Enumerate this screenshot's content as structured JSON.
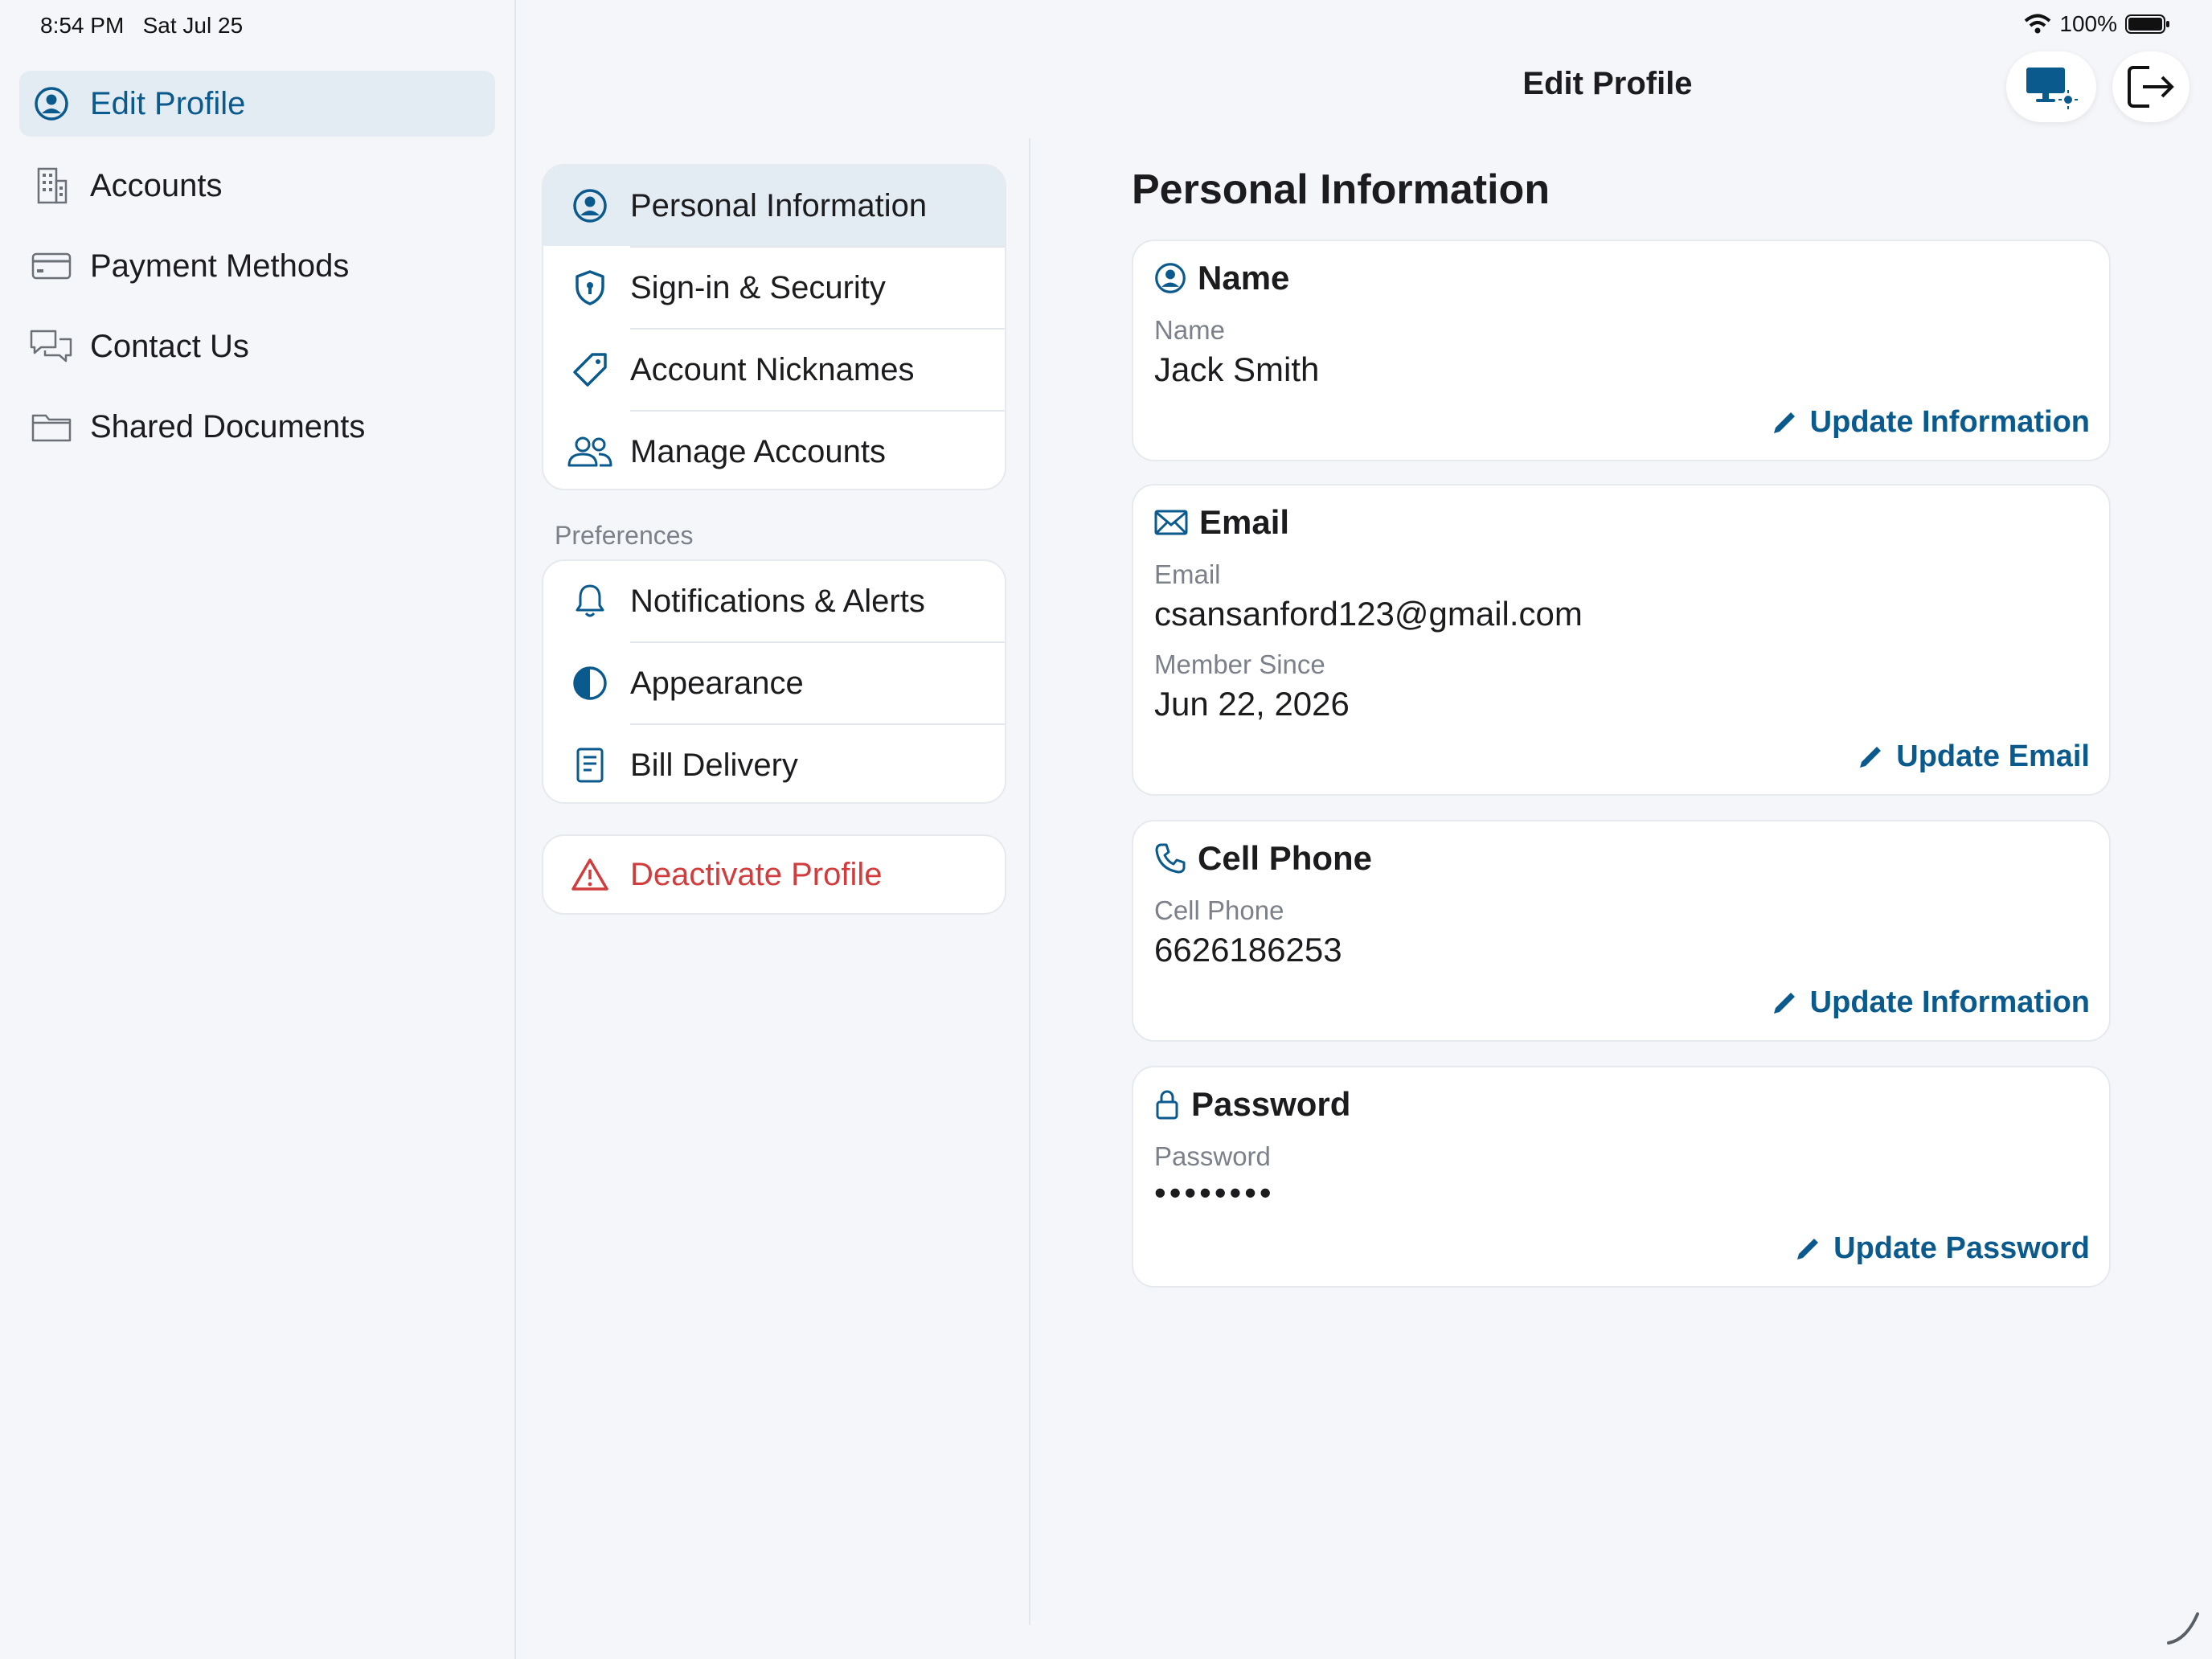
{
  "status_bar": {
    "time": "8:54 PM",
    "date": "Sat Jul 25",
    "battery": "100%"
  },
  "sidebar": {
    "items": [
      {
        "label": "Edit Profile",
        "icon": "person-circle-icon",
        "active": true
      },
      {
        "label": "Accounts",
        "icon": "building-icon"
      },
      {
        "label": "Payment Methods",
        "icon": "credit-card-icon"
      },
      {
        "label": "Contact Us",
        "icon": "chat-bubbles-icon"
      },
      {
        "label": "Shared Documents",
        "icon": "folder-icon"
      }
    ]
  },
  "header": {
    "title": "Edit Profile",
    "display_button_icon": "display-brightness-icon",
    "logout_button_icon": "logout-icon"
  },
  "menu": {
    "main": [
      {
        "label": "Personal Information",
        "icon": "person-circle-icon",
        "active": true
      },
      {
        "label": "Sign-in & Security",
        "icon": "shield-icon"
      },
      {
        "label": "Account Nicknames",
        "icon": "tag-icon"
      },
      {
        "label": "Manage Accounts",
        "icon": "people-icon"
      }
    ],
    "preferences_header": "Preferences",
    "preferences": [
      {
        "label": "Notifications & Alerts",
        "icon": "bell-icon"
      },
      {
        "label": "Appearance",
        "icon": "half-circle-icon"
      },
      {
        "label": "Bill Delivery",
        "icon": "document-icon"
      }
    ],
    "deactivate": {
      "label": "Deactivate Profile",
      "icon": "warning-icon",
      "color": "#d23c3c"
    }
  },
  "content": {
    "title": "Personal Information",
    "cards": {
      "name": {
        "title": "Name",
        "label": "Name",
        "value": "Jack Smith",
        "action": "Update Information"
      },
      "email": {
        "title": "Email",
        "label": "Email",
        "value": "csansanford123@gmail.com",
        "label2": "Member Since",
        "value2": "Jun 22, 2026",
        "action": "Update Email"
      },
      "phone": {
        "title": "Cell Phone",
        "label": "Cell Phone",
        "value": "6626186253",
        "action": "Update Information"
      },
      "password": {
        "title": "Password",
        "label": "Password",
        "value": "••••••••",
        "action": "Update Password"
      }
    }
  },
  "colors": {
    "accent": "#0b5a8e",
    "danger": "#d23c3c",
    "background": "#f4f6f9"
  }
}
